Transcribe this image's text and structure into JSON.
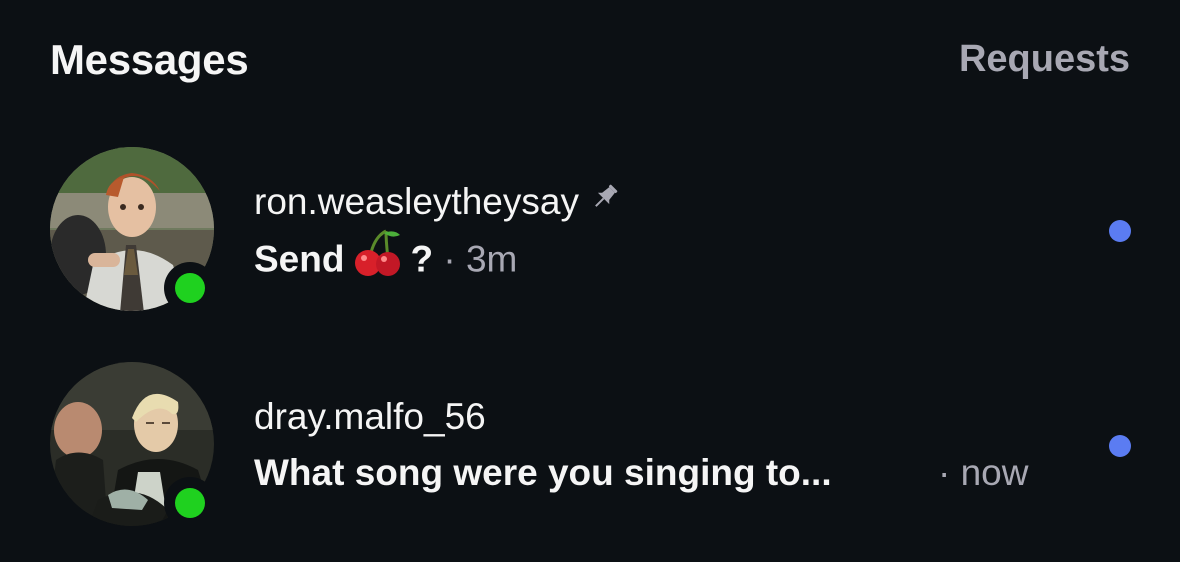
{
  "header": {
    "title": "Messages",
    "requests_label": "Requests"
  },
  "threads": [
    {
      "username": "ron.weasleytheysay",
      "pinned": true,
      "preview_text": "Send",
      "preview_emoji": "cherries",
      "preview_suffix": "?",
      "separator": "·",
      "time": "3m",
      "online": true,
      "unread": true
    },
    {
      "username": "dray.malfo_56",
      "pinned": false,
      "preview_text": "What song were you singing to...",
      "separator": "·",
      "time": "now",
      "online": true,
      "unread": true
    }
  ],
  "colors": {
    "background": "#0c1014",
    "text_primary": "#f5f5f5",
    "text_secondary": "#a8a8b3",
    "online": "#1fd11f",
    "unread": "#5b7cf2"
  },
  "icons": {
    "pin": "pushpin-icon",
    "emoji": "cherries-emoji"
  }
}
